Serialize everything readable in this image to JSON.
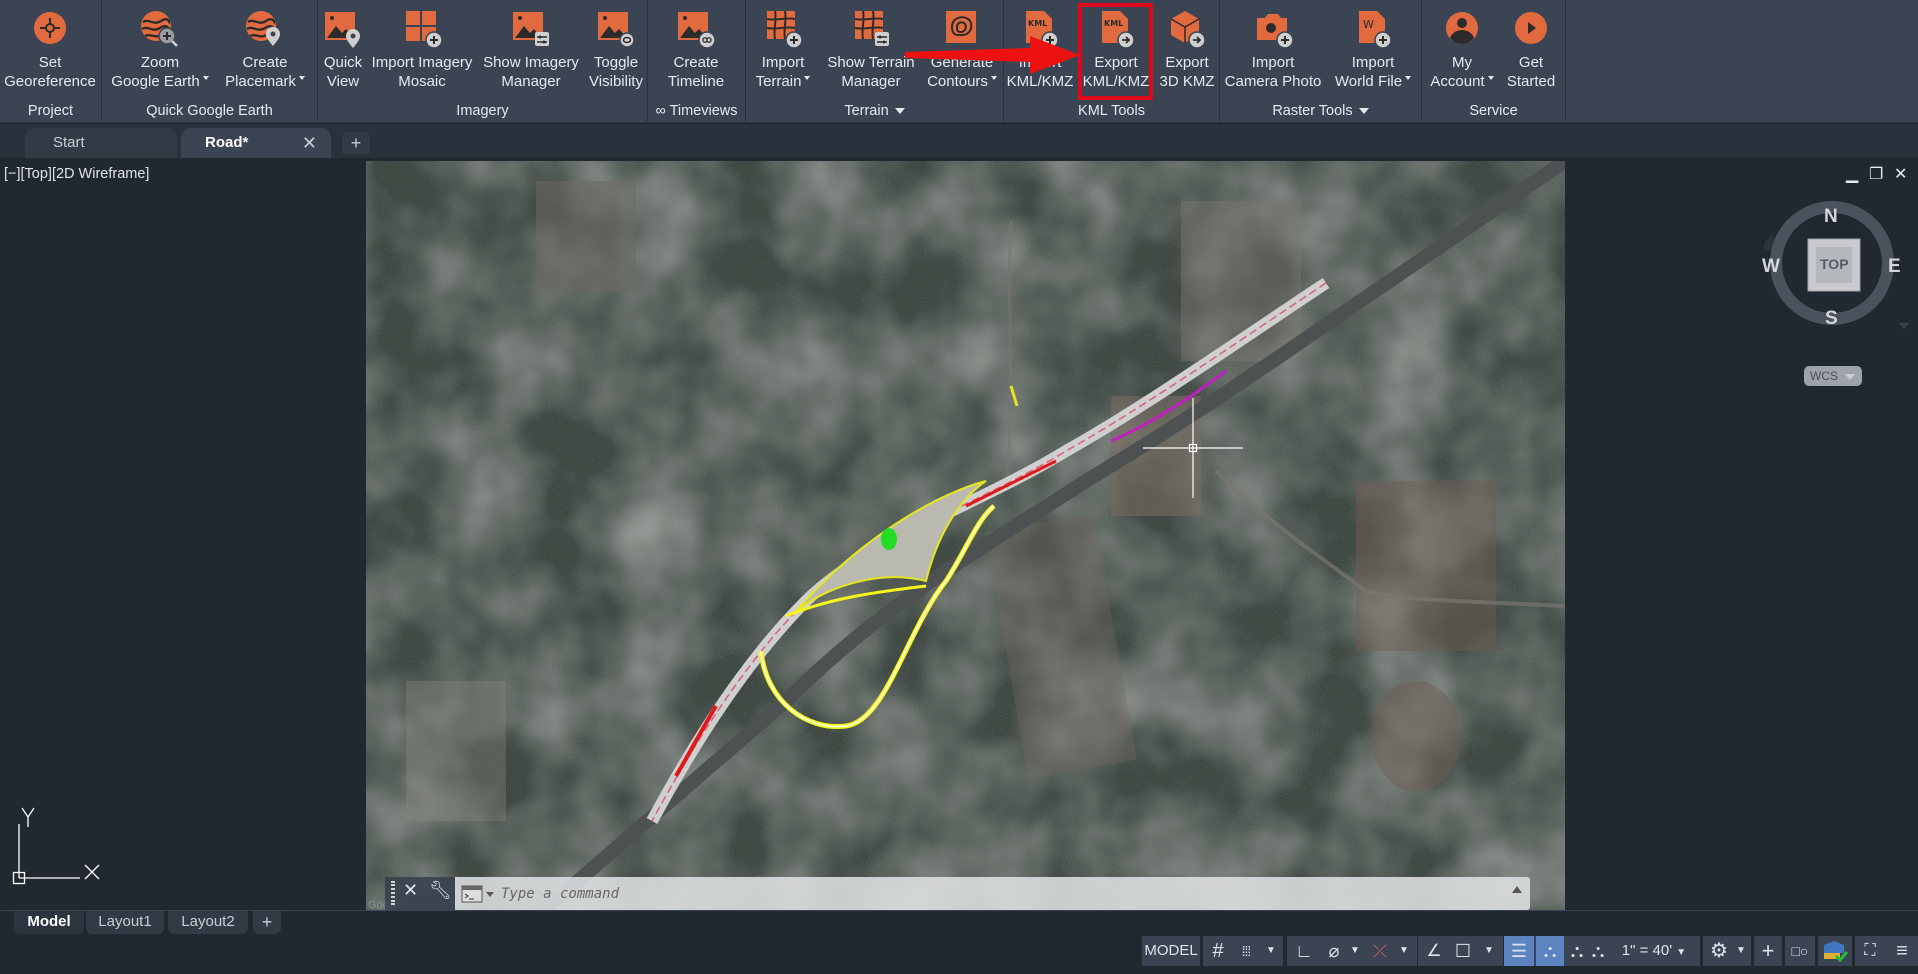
{
  "ribbon": {
    "panels": [
      {
        "title": "Project",
        "buttons": [
          {
            "label1": "Set",
            "label2": "Georeference",
            "icon": "georeference-icon"
          }
        ]
      },
      {
        "title": "Quick Google Earth",
        "buttons": [
          {
            "label1": "Zoom",
            "label2": "Google Earth",
            "icon": "zoom-google-earth-icon",
            "dropdown": true
          },
          {
            "label1": "Create",
            "label2": "Placemark",
            "icon": "create-placemark-icon",
            "dropdown": true
          }
        ]
      },
      {
        "title": "Imagery",
        "buttons": [
          {
            "label1": "Quick",
            "label2": "View",
            "icon": "quick-view-icon"
          },
          {
            "label1": "Import Imagery",
            "label2": "Mosaic",
            "icon": "import-mosaic-icon"
          },
          {
            "label1": "Show Imagery",
            "label2": "Manager",
            "icon": "imagery-manager-icon"
          },
          {
            "label1": "Toggle",
            "label2": "Visibility",
            "icon": "toggle-visibility-icon"
          }
        ]
      },
      {
        "title": "∞ Timeviews",
        "buttons": [
          {
            "label1": "Create",
            "label2": "Timeline",
            "icon": "create-timeline-icon"
          }
        ]
      },
      {
        "title": "Terrain",
        "title_dropdown": true,
        "buttons": [
          {
            "label1": "Import",
            "label2": "Terrain",
            "icon": "import-terrain-icon",
            "dropdown": true
          },
          {
            "label1": "Show Terrain",
            "label2": "Manager",
            "icon": "terrain-manager-icon"
          },
          {
            "label1": "Generate",
            "label2": "Contours",
            "icon": "generate-contours-icon",
            "dropdown": true
          }
        ]
      },
      {
        "title": "KML Tools",
        "buttons": [
          {
            "label1": "Import",
            "label2": "KML/KMZ",
            "icon": "import-kml-icon"
          },
          {
            "label1": "Export",
            "label2": "KML/KMZ",
            "icon": "export-kml-icon",
            "highlighted": true
          },
          {
            "label1": "Export",
            "label2": "3D KMZ",
            "icon": "export-3d-kmz-icon"
          }
        ]
      },
      {
        "title": "Raster Tools",
        "title_dropdown": true,
        "buttons": [
          {
            "label1": "Import",
            "label2": "Camera Photo",
            "icon": "import-camera-photo-icon"
          },
          {
            "label1": "Import",
            "label2": "World File",
            "icon": "import-world-file-icon",
            "dropdown": true
          }
        ]
      },
      {
        "title": "Service",
        "buttons": [
          {
            "label1": "My",
            "label2": "Account",
            "icon": "account-icon",
            "dropdown": true
          },
          {
            "label1": "Get",
            "label2": "Started",
            "icon": "get-started-icon"
          }
        ]
      }
    ]
  },
  "doc_tabs": [
    {
      "label": "Start",
      "active": false
    },
    {
      "label": "Road*",
      "active": true
    }
  ],
  "viewport": {
    "label": "[−][Top][2D Wireframe]",
    "viewcube": {
      "north": "N",
      "south": "S",
      "east": "E",
      "west": "W",
      "face": "TOP",
      "coord_system": "WCS"
    },
    "ucs": {
      "x": "X",
      "y": "Y"
    },
    "attribution": "Google"
  },
  "command_line": {
    "placeholder": "Type a command"
  },
  "layout_tabs": [
    {
      "label": "Model",
      "active": true
    },
    {
      "label": "Layout1",
      "active": false
    },
    {
      "label": "Layout2",
      "active": false
    }
  ],
  "status_bar": {
    "space": "MODEL",
    "annotation_scale": "1\" = 40'"
  },
  "colors": {
    "accent_orange": "#e16b3f",
    "highlight_red": "#e0081a",
    "ribbon_bg": "#3b4453",
    "app_bg": "#212830",
    "status_active": "#5b84c0"
  }
}
